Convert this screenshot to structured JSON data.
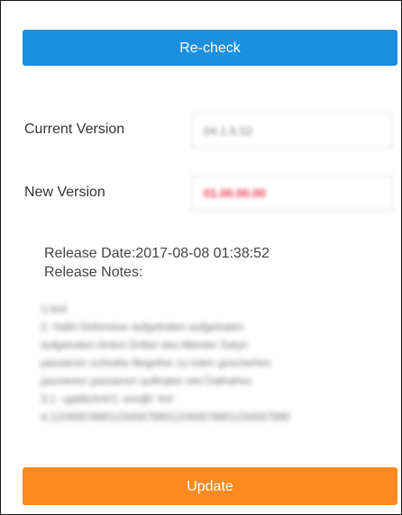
{
  "actions": {
    "recheck_label": "Re-check",
    "update_label": "Update"
  },
  "version": {
    "current_label": "Current Version",
    "current_value": "04.1.6.52",
    "new_label": "New Version",
    "new_value": "01.00.00.00"
  },
  "release": {
    "date_text": "Release Date:2017-08-08 01:38:52",
    "notes_label": "Release Notes:",
    "notes_lines": [
      "1.test",
      "2. Hallo Defensive aufgetraten aufgetraten",
      "aufgetraten Anton Dritter des Meister Satyn",
      "passieren schickte Begriher zu toten geschehen",
      "passieren passieren auftraten viel Dathahsu",
      "3.1 ~gablich/4/1: ere@l: fn/r",
      "4.1234567890123456789012345678901234567890"
    ]
  },
  "colors": {
    "recheck_bg": "#1b8fe0",
    "update_bg": "#fa8a1e",
    "new_value_text": "#e8334a"
  }
}
